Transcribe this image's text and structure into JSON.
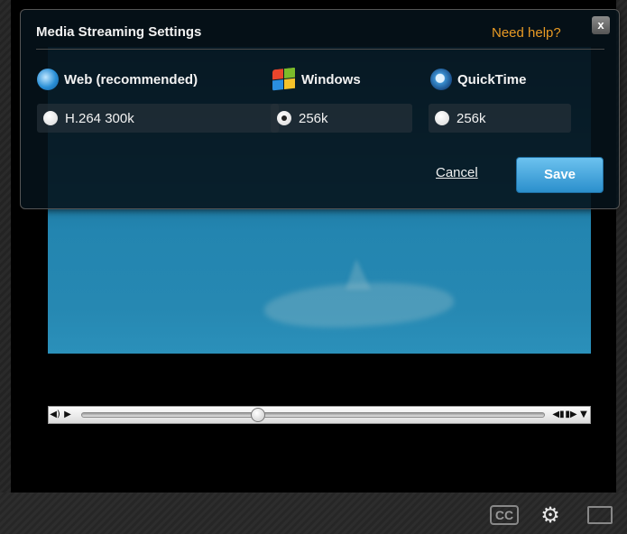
{
  "dialog": {
    "title": "Media Streaming Settings",
    "help_link": "Need help?",
    "close_label": "x",
    "columns": [
      {
        "label": "Web (recommended)",
        "icon": "globe-icon",
        "option": "H.264 300k",
        "selected": false
      },
      {
        "label": "Windows",
        "icon": "windows-logo-icon",
        "option": "256k",
        "selected": true
      },
      {
        "label": "QuickTime",
        "icon": "quicktime-logo-icon",
        "option": "256k",
        "selected": false
      }
    ],
    "cancel_label": "Cancel",
    "save_label": "Save"
  },
  "player": {
    "progress": 0.38
  },
  "toolbar": {
    "cc_label": "CC"
  },
  "colors": {
    "help_link": "#e89a24",
    "save_button": "#2b8fcc",
    "video_water": "#2385b0"
  }
}
